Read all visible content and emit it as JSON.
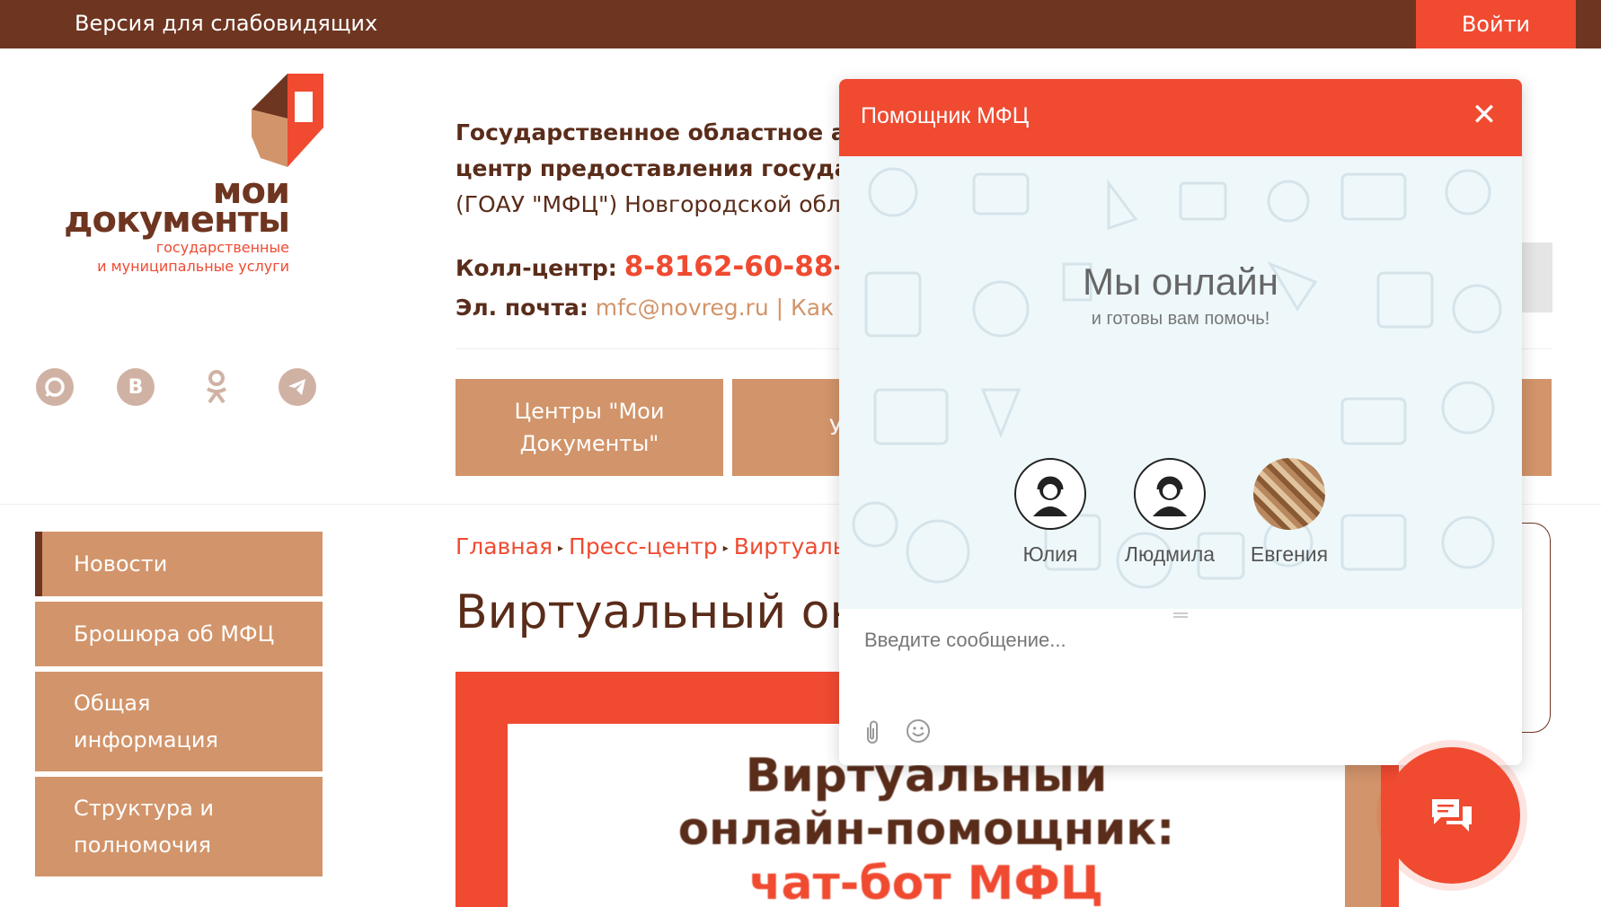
{
  "topbar": {
    "vision_label": "Версия для слабовидящих",
    "login_label": "Войти"
  },
  "logo": {
    "line1": "мои",
    "line2": "документы",
    "sub1": "государственные",
    "sub2": "и муниципальные услуги"
  },
  "social": [
    {
      "name": "max-icon"
    },
    {
      "name": "vk-icon",
      "glyph": "В"
    },
    {
      "name": "odnoklassniki-icon",
      "glyph": "ꝏ"
    },
    {
      "name": "telegram-icon"
    }
  ],
  "header": {
    "org_line1": "Государственное областное а",
    "org_line2": "центр предоставления госуда",
    "org_line3": "(ГОАУ \"МФЦ\") Новгородской обл",
    "callcenter_label": "Колл-центр:",
    "callcenter_phone": "8-8162-60-88-",
    "email_label": "Эл. почта:",
    "email_value": "mfc@novreg.ru",
    "email_suffix": " | Как"
  },
  "nav": {
    "btn1_line1": "Центры \"Мои",
    "btn1_line2": "Документы\"",
    "btn2_partial": "У"
  },
  "sidebar": {
    "items": [
      {
        "label": "Новости"
      },
      {
        "label": "Брошюра об МФЦ"
      },
      {
        "label_l1": "Общая",
        "label_l2": "информация"
      },
      {
        "label_l1": "Структура и",
        "label_l2": "полномочия"
      }
    ]
  },
  "breadcrumbs": {
    "home": "Главная",
    "press": "Пресс-центр",
    "current": "Виртуальны"
  },
  "page": {
    "title": "Виртуальный онл"
  },
  "banner": {
    "line1": "Виртуальный",
    "line2": "онлайн-помощник:",
    "line3": "чат-бот МФЦ"
  },
  "chat": {
    "title": "Помощник МФЦ",
    "close_glyph": "✕",
    "online_heading": "Мы онлайн",
    "online_sub": "и готовы вам помочь!",
    "agents": [
      {
        "name": "Юлия"
      },
      {
        "name": "Людмила"
      },
      {
        "name": "Евгения"
      }
    ],
    "input_placeholder": "Введите сообщение..."
  },
  "colors": {
    "brand_red": "#f04a31",
    "brand_brown": "#6e3520",
    "menu_tan": "#d2946a"
  }
}
